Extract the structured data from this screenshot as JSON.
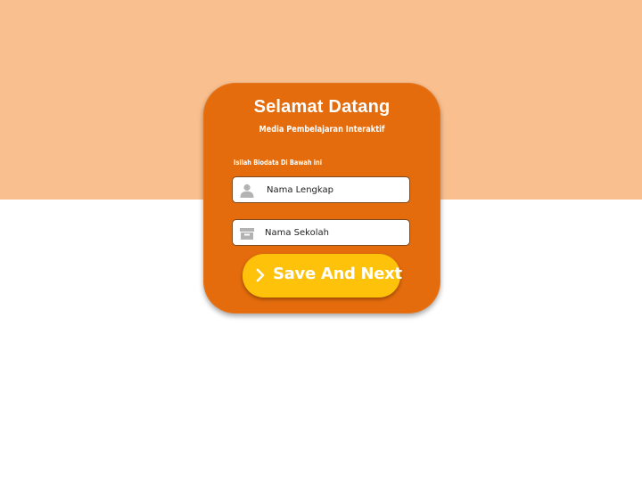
{
  "card": {
    "title": "Selamat Datang",
    "subtitle": "Media Pembelajaran Interaktif",
    "instruction": "Isilah Biodata Di Bawah ini"
  },
  "form": {
    "name_placeholder": "Nama Lengkap",
    "name_icon": "user-icon",
    "school_placeholder": "Nama Sekolah",
    "school_icon": "archive-box-icon"
  },
  "actions": {
    "save_label": "Save And Next",
    "save_icon": "chevron-right-icon"
  },
  "colors": {
    "background_top": "#f9bf8f",
    "background_bottom": "#ffffff",
    "card": "#e56c0c",
    "button": "#ffc20a",
    "text_light": "#ffffff"
  }
}
